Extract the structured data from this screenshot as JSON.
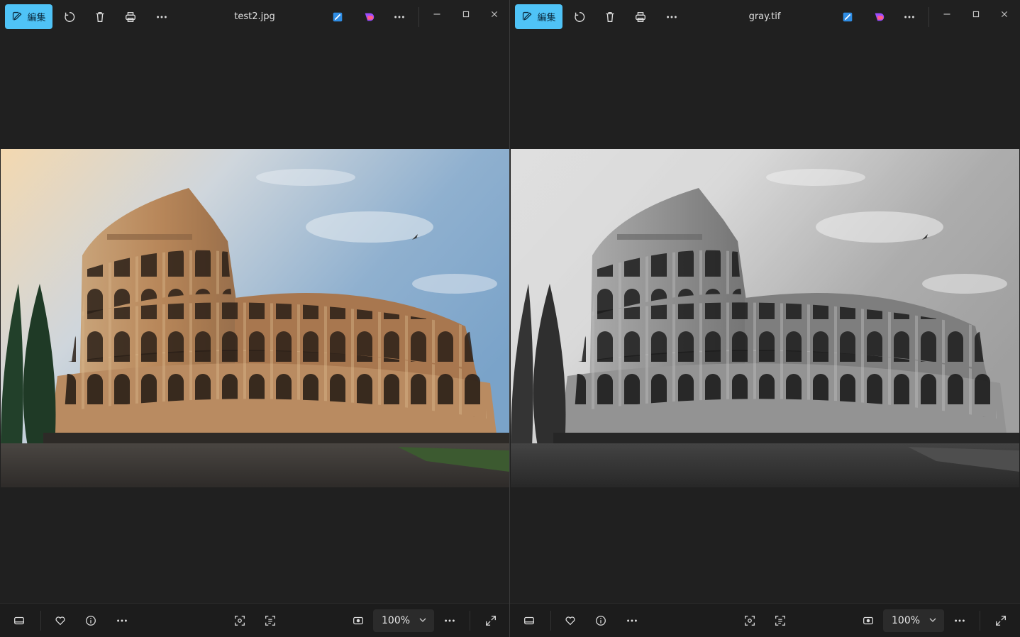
{
  "windows": [
    {
      "id": "left",
      "title": "test2.jpg",
      "edit_label": "編集",
      "zoom": "100%",
      "image_mode": "color"
    },
    {
      "id": "right",
      "title": "gray.tif",
      "edit_label": "編集",
      "zoom": "100%",
      "image_mode": "grayscale"
    }
  ],
  "colors": {
    "accent": "#4fc3f7",
    "background": "#202020",
    "toolbar": "#1c1c1c"
  },
  "icons": {
    "top": [
      "edit-icon",
      "rotate-icon",
      "trash-icon",
      "print-icon",
      "more-icon",
      "editor-icon",
      "copilot-icon",
      "more-icon",
      "minimize-icon",
      "maximize-icon",
      "close-icon"
    ],
    "bottom": [
      "filmstrip-icon",
      "favorite-icon",
      "info-icon",
      "more-icon",
      "visual-search-icon",
      "text-scan-icon",
      "fit-icon",
      "chevron-down-icon",
      "more-icon",
      "fullscreen-icon"
    ]
  }
}
